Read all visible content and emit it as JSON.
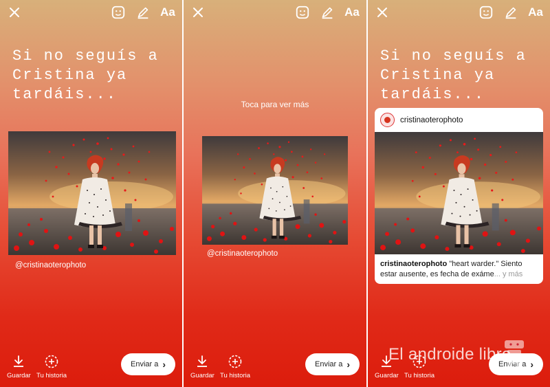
{
  "story": {
    "text": "Si no seguís a\nCristina ya\ntardáis...",
    "tap_hint": "Toca para ver más",
    "mention": "@cristinaoterophoto",
    "aa_label": "Aa"
  },
  "card": {
    "username": "cristinaoterophoto",
    "caption_user": "cristinaoterophoto",
    "caption_text": " \"heart warder.\" Siento estar ausente, es fecha de exáme",
    "caption_more": "... y más"
  },
  "bottom": {
    "save_label": "Guardar",
    "story_label": "Tu historia",
    "send_label": "Enviar a"
  },
  "watermark": {
    "text": "El androide libre"
  },
  "icons": {
    "close": "close-icon",
    "sticker": "sticker-icon",
    "draw": "pen-icon",
    "save": "download-icon",
    "story": "add-story-icon",
    "send": "chevron-right-icon"
  },
  "colors": {
    "gradient_top": "#d8b07a",
    "gradient_bottom": "#dc1c0c",
    "button_bg": "#ffffff"
  }
}
